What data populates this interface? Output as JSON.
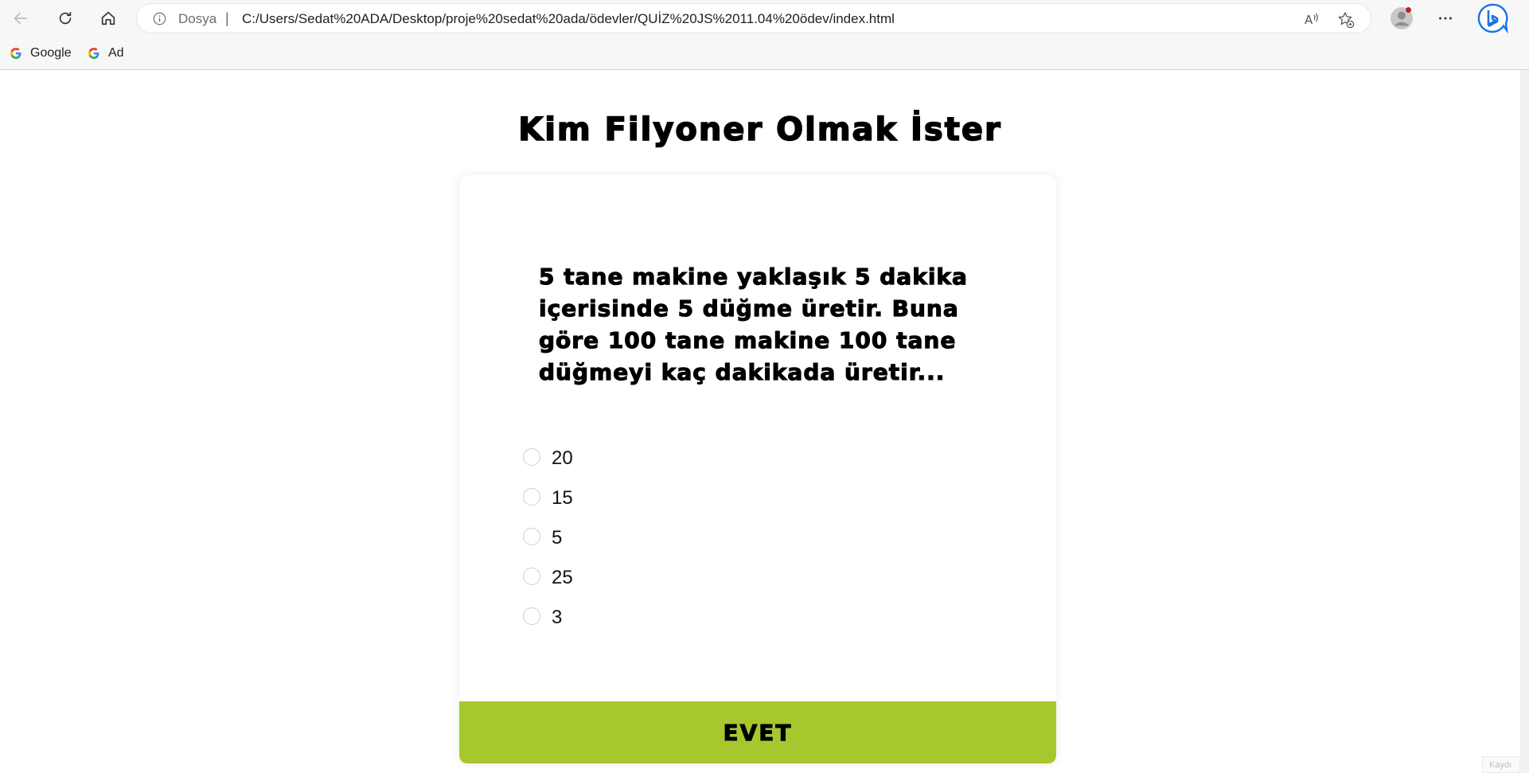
{
  "browser": {
    "address": {
      "scheme_label": "Dosya",
      "separator": "|",
      "url": "C:/Users/Sedat%20ADA/Desktop/proje%20sedat%20ada/ödevler/QUİZ%20JS%2011.04%20ödev/index.html"
    },
    "bookmarks": [
      {
        "label": "Google",
        "icon": "google-icon"
      },
      {
        "label": "Ad",
        "icon": "google-icon"
      }
    ],
    "icons": [
      "back-icon",
      "reload-icon",
      "home-icon",
      "info-icon",
      "read-aloud-icon",
      "favorite-add-icon",
      "profile-icon",
      "more-icon",
      "bing-icon"
    ],
    "corner_badge": "Kaydı"
  },
  "quiz": {
    "title": "Kim Filyoner Olmak İster",
    "question": "5 tane makine yaklaşık 5 dakika içerisinde 5 düğme üretir. Buna göre 100 tane makine 100 tane düğmeyi kaç dakikada üretir...",
    "answers": [
      "20",
      "15",
      "5",
      "25",
      "3"
    ],
    "submit_label": "EVET"
  },
  "colors": {
    "submit_button": "#a6c82e",
    "browser_chrome": "#f7f7f7",
    "page_background": "#ffffff"
  }
}
